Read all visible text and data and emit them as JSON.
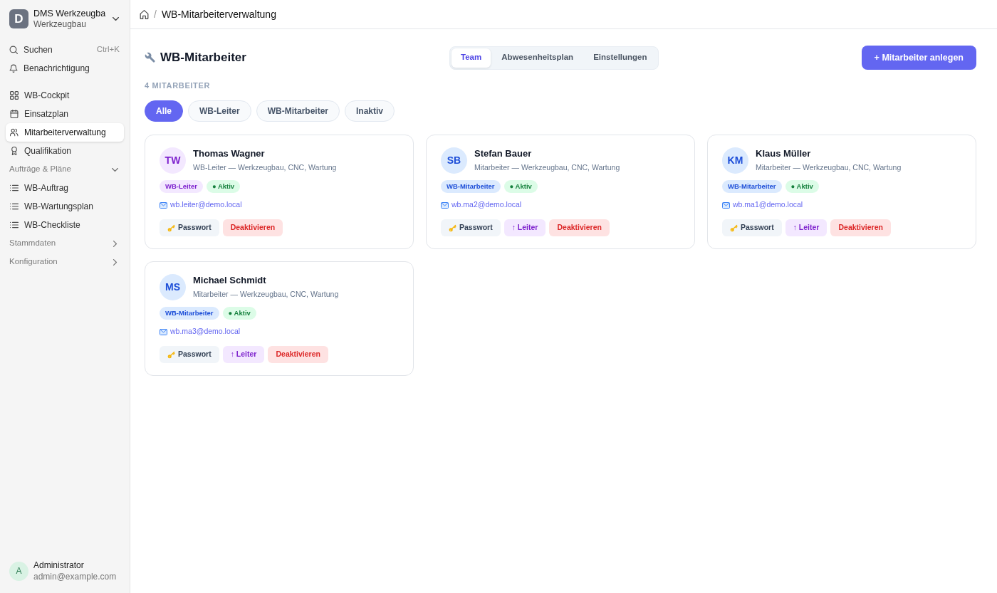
{
  "sidebar": {
    "workspace": {
      "initial": "D",
      "name": "DMS Werkzeugba",
      "subtitle": "Werkzeugbau"
    },
    "tools": [
      {
        "label": "Suchen",
        "shortcut": "Ctrl+K"
      },
      {
        "label": "Benachrichtigung"
      }
    ],
    "nav": [
      {
        "label": "WB-Cockpit",
        "selected": false
      },
      {
        "label": "Einsatzplan",
        "selected": false
      },
      {
        "label": "Mitarbeiterverwaltung",
        "selected": true
      },
      {
        "label": "Qualifikation",
        "selected": false
      }
    ],
    "groups": [
      {
        "label": "Aufträge & Pläne",
        "expanded": true,
        "children": [
          {
            "label": "WB-Auftrag",
            "selected": false
          },
          {
            "label": "WB-Wartungsplan",
            "selected": false
          },
          {
            "label": "WB-Checkliste",
            "selected": false
          }
        ]
      },
      {
        "label": "Stammdaten",
        "expanded": false
      },
      {
        "label": "Konfiguration",
        "expanded": false
      }
    ],
    "user": {
      "initial": "A",
      "name": "Administrator",
      "email": "admin@example.com"
    }
  },
  "breadcrumb": {
    "separator": "/",
    "current": "WB-Mitarbeiterverwaltung"
  },
  "header": {
    "title": "WB-Mitarbeiter",
    "tabs": [
      {
        "label": "Team",
        "selected": true
      },
      {
        "label": "Abwesenheitsplan",
        "selected": false
      },
      {
        "label": "Einstellungen",
        "selected": false
      }
    ],
    "primary_action": "+ Mitarbeiter anlegen"
  },
  "count": "4 MITARBEITER",
  "filters": [
    {
      "label": "Alle",
      "selected": true
    },
    {
      "label": "WB-Leiter",
      "selected": false
    },
    {
      "label": "WB-Mitarbeiter",
      "selected": false
    },
    {
      "label": "Inaktiv",
      "selected": false
    }
  ],
  "employees": [
    {
      "initials": "TW",
      "name": "Thomas Wagner",
      "details": "WB-Leiter — Werkzeugbau, CNC, Wartung",
      "role": {
        "label": "WB-Leiter",
        "kind": "leader"
      },
      "status": {
        "label": "● Aktiv",
        "active": true
      },
      "email": "wb.leiter@demo.local",
      "actions": [
        {
          "label": "Passwort",
          "kind": "password"
        },
        {
          "label": "Deaktivieren",
          "kind": "deactivate"
        }
      ]
    },
    {
      "initials": "SB",
      "name": "Stefan Bauer",
      "details": "Mitarbeiter — Werkzeugbau, CNC, Wartung",
      "role": {
        "label": "WB-Mitarbeiter",
        "kind": "member"
      },
      "status": {
        "label": "● Aktiv",
        "active": true
      },
      "email": "wb.ma2@demo.local",
      "actions": [
        {
          "label": "Passwort",
          "kind": "password"
        },
        {
          "label": "↑ Leiter",
          "kind": "promote"
        },
        {
          "label": "Deaktivieren",
          "kind": "deactivate"
        }
      ]
    },
    {
      "initials": "KM",
      "name": "Klaus Müller",
      "details": "Mitarbeiter — Werkzeugbau, CNC, Wartung",
      "role": {
        "label": "WB-Mitarbeiter",
        "kind": "member"
      },
      "status": {
        "label": "● Aktiv",
        "active": true
      },
      "email": "wb.ma1@demo.local",
      "actions": [
        {
          "label": "Passwort",
          "kind": "password"
        },
        {
          "label": "↑ Leiter",
          "kind": "promote"
        },
        {
          "label": "Deaktivieren",
          "kind": "deactivate"
        }
      ]
    },
    {
      "initials": "MS",
      "name": "Michael Schmidt",
      "details": "Mitarbeiter — Werkzeugbau, CNC, Wartung",
      "role": {
        "label": "WB-Mitarbeiter",
        "kind": "member"
      },
      "status": {
        "label": "● Aktiv",
        "active": true
      },
      "email": "wb.ma3@demo.local",
      "actions": [
        {
          "label": "Passwort",
          "kind": "password"
        },
        {
          "label": "↑ Leiter",
          "kind": "promote"
        },
        {
          "label": "Deaktivieren",
          "kind": "deactivate"
        }
      ]
    }
  ]
}
